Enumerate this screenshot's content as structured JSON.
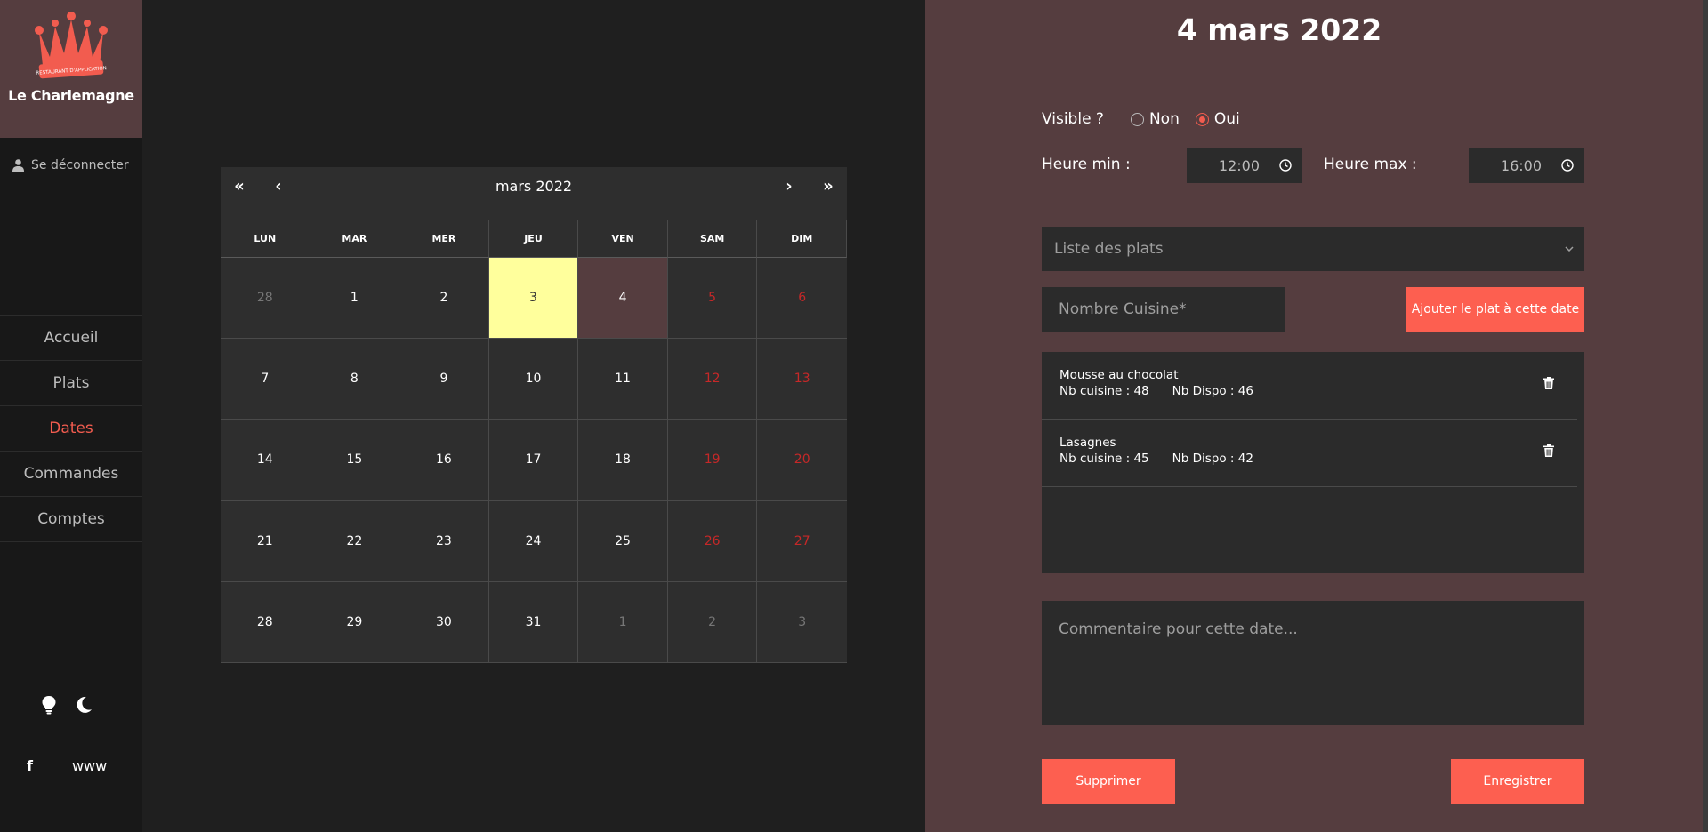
{
  "sidebar": {
    "logo_banner": "RESTAURANT D'APPLICATION",
    "brand_name": "Le Charlemagne",
    "logout_label": "Se déconnecter",
    "nav": [
      {
        "label": "Accueil"
      },
      {
        "label": "Plats"
      },
      {
        "label": "Dates",
        "active": true
      },
      {
        "label": "Commandes"
      },
      {
        "label": "Comptes"
      }
    ],
    "social": {
      "facebook_icon": "f",
      "web_label": "www"
    }
  },
  "calendar": {
    "title": "mars 2022",
    "nav": {
      "first": "«",
      "prev": "‹",
      "next": "›",
      "last": "»"
    },
    "weekdays": [
      "LUN",
      "MAR",
      "MER",
      "JEU",
      "VEN",
      "SAM",
      "DIM"
    ],
    "weeks": [
      [
        "28",
        "1",
        "2",
        "3",
        "4",
        "5",
        "6"
      ],
      [
        "7",
        "8",
        "9",
        "10",
        "11",
        "12",
        "13"
      ],
      [
        "14",
        "15",
        "16",
        "17",
        "18",
        "19",
        "20"
      ],
      [
        "21",
        "22",
        "23",
        "24",
        "25",
        "26",
        "27"
      ],
      [
        "28",
        "29",
        "30",
        "31",
        "1",
        "2",
        "3"
      ]
    ],
    "today": "3",
    "selected": "4"
  },
  "panel": {
    "title": "4 mars 2022",
    "visible_label": "Visible ?",
    "visible_options": [
      "Non",
      "Oui"
    ],
    "visible_value": "Oui",
    "heure_min_label": "Heure min :",
    "heure_min_value": "12:00",
    "heure_max_label": "Heure max :",
    "heure_max_value": "16:00",
    "dish_select_placeholder": "Liste des plats",
    "nb_cuisine_placeholder": "Nombre Cuisine*",
    "add_button": "Ajouter le plat à cette date",
    "dishes": [
      {
        "name": "Mousse au chocolat",
        "nb_cuisine": "Nb cuisine : 48",
        "nb_dispo": "Nb Dispo : 46"
      },
      {
        "name": "Lasagnes",
        "nb_cuisine": "Nb cuisine : 45",
        "nb_dispo": "Nb Dispo : 42"
      }
    ],
    "comment_placeholder": "Commentaire pour cette date...",
    "delete_button": "Supprimer",
    "save_button": "Enregistrer"
  },
  "colors": {
    "accent": "#fd5f50",
    "panel_bg": "#553d3f",
    "today_bg": "#ffff9c",
    "weekend_text": "#c62828"
  }
}
